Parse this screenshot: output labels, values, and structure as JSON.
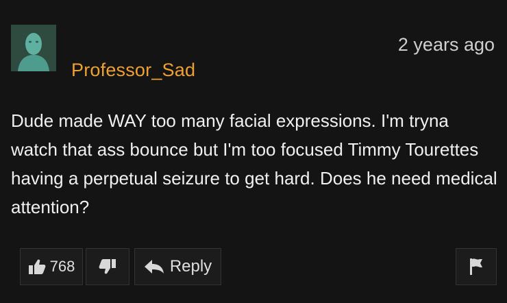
{
  "comment": {
    "username": "Professor_Sad",
    "timestamp": "2 years ago",
    "body": "Dude made WAY too many facial expressions. I'm tryna watch that ass bounce but I'm too focused Timmy Tourettes having a perpetual seizure to get hard. Does he need medical attention?",
    "upvote_count": "768",
    "reply_label": "Reply",
    "colors": {
      "background": "#141414",
      "username": "#f0a030",
      "text": "#f0f0f0"
    },
    "icons": {
      "upvote": "thumbs-up-icon",
      "downvote": "thumbs-down-icon",
      "reply": "reply-arrow-icon",
      "flag": "flag-icon"
    }
  }
}
